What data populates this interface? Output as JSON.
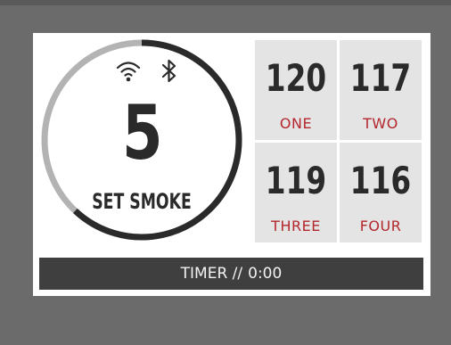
{
  "smoke_dial": {
    "value": "5",
    "label": "SET SMOKE",
    "progress_fraction": 0.62,
    "status_icons": [
      "wifi-icon",
      "bluetooth-icon"
    ],
    "colors": {
      "track": "#b3b3b3",
      "progress": "#2a2a2a"
    }
  },
  "probes": [
    {
      "temp": "120",
      "name": "ONE"
    },
    {
      "temp": "117",
      "name": "TWO"
    },
    {
      "temp": "119",
      "name": "THREE"
    },
    {
      "temp": "116",
      "name": "FOUR"
    }
  ],
  "timer": {
    "label": "TIMER //",
    "value": "0:00"
  },
  "colors": {
    "accent_red": "#b3272d",
    "tile_bg": "#e4e4e4",
    "timer_bg": "#3f3f3f",
    "bezel": "#6b6b6b"
  }
}
